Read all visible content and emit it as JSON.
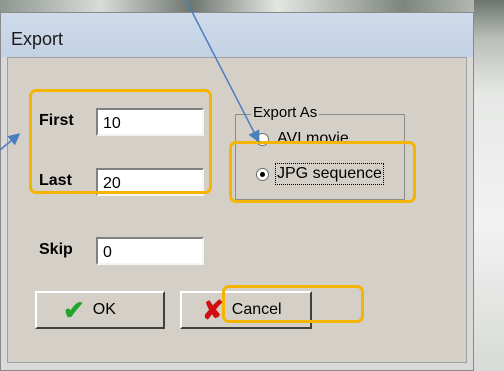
{
  "dialog": {
    "title": "Export"
  },
  "frame_fields": {
    "first_label": "First",
    "first_value": "10",
    "last_label": "Last",
    "last_value": "20",
    "skip_label": "Skip",
    "skip_value": "0"
  },
  "export_as": {
    "group_label": "Export As",
    "options": [
      {
        "label": "AVI movie",
        "selected": false
      },
      {
        "label": "JPG sequence",
        "selected": true
      }
    ]
  },
  "buttons": {
    "ok_label": "OK",
    "ok_icon": "checkmark-icon",
    "cancel_label": "Cancel",
    "cancel_icon": "x-icon"
  },
  "annotations": {
    "highlight_color": "#f5b400",
    "arrow_color": "#4a7fbf"
  }
}
